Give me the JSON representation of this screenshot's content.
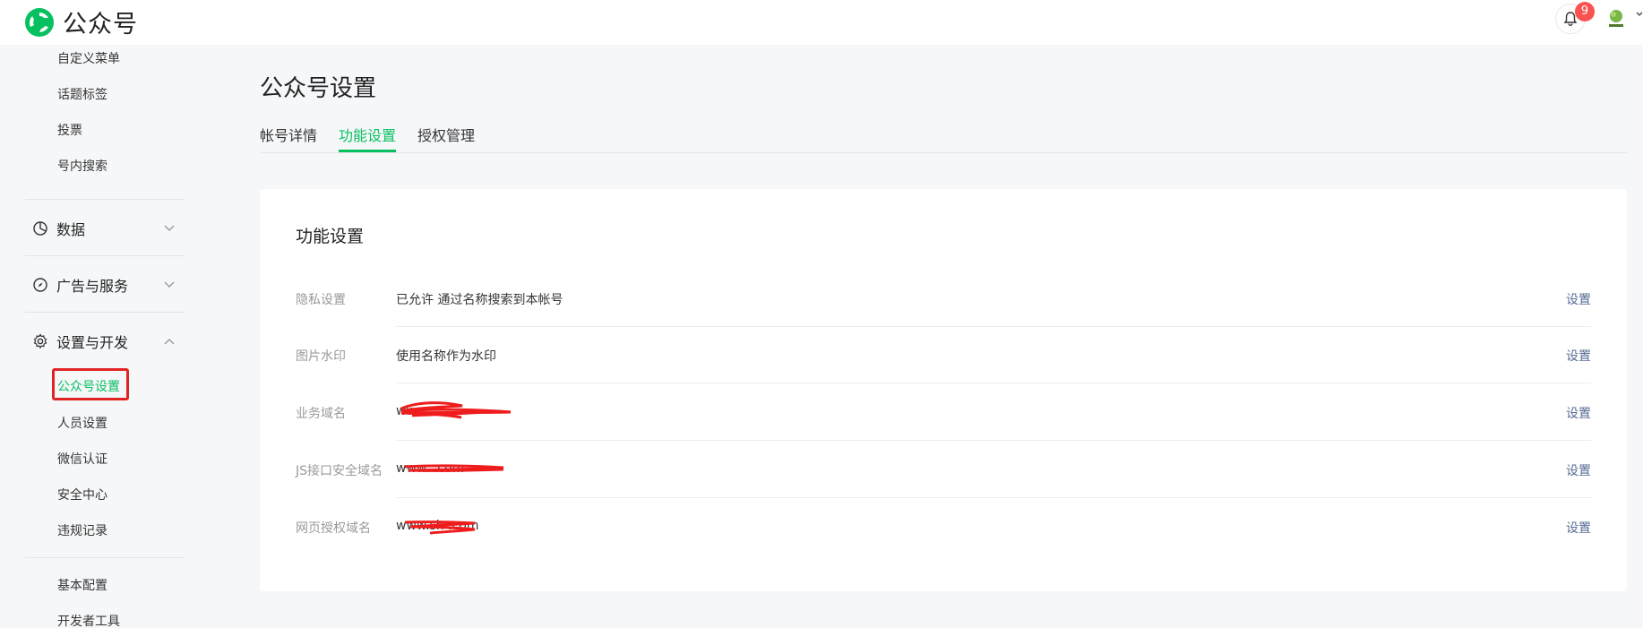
{
  "header": {
    "app_title": "公众号",
    "notifications_count": "9",
    "colors": {
      "brand": "#07c160",
      "badge": "#fa5151"
    }
  },
  "sidebar": {
    "top_items": [
      "自定义菜单",
      "话题标签",
      "投票",
      "号内搜索"
    ],
    "groups": [
      {
        "label": "数据",
        "icon": "pie-chart-icon",
        "expanded": false
      },
      {
        "label": "广告与服务",
        "icon": "compass-icon",
        "expanded": false
      },
      {
        "label": "设置与开发",
        "icon": "gear-icon",
        "expanded": true
      }
    ],
    "settings_items": [
      "公众号设置",
      "人员设置",
      "微信认证",
      "安全中心",
      "违规记录"
    ],
    "dev_items": [
      "基本配置",
      "开发者工具"
    ],
    "active_item": "公众号设置"
  },
  "main": {
    "page_title": "公众号设置",
    "tabs": [
      "帐号详情",
      "功能设置",
      "授权管理"
    ],
    "active_tab": "功能设置",
    "card": {
      "title": "功能设置",
      "rows": [
        {
          "label": "隐私设置",
          "value": "已允许 通过名称搜索到本帐号",
          "action": "设置"
        },
        {
          "label": "图片水印",
          "value": "使用名称作为水印",
          "action": "设置"
        },
        {
          "label": "业务域名",
          "value": "www.",
          "action": "设置"
        },
        {
          "label": "JS接口安全域名",
          "value": "www.                .com",
          "action": "设置"
        },
        {
          "label": "网页授权域名",
          "value": "www.sh            .com",
          "action": "设置"
        }
      ]
    }
  }
}
